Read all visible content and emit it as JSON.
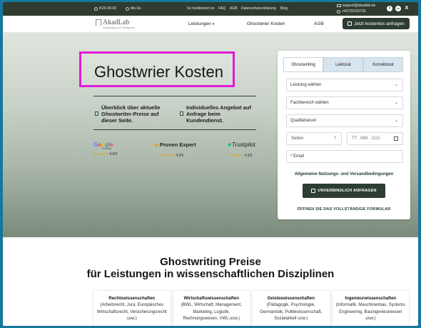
{
  "topbar": {
    "hours": "8.00-20.00",
    "days": "Mo-So",
    "links": [
      "So funktioniert es",
      "FAQ",
      "AGB",
      "Datenschutzerklärung",
      "Blog"
    ],
    "email": "support@akadlab.de",
    "phone": "+43720143726",
    "socials": [
      "f",
      "in",
      "X"
    ]
  },
  "header": {
    "logo_name": "AkadLab",
    "logo_sub": "Ghostwriting von Textagentur",
    "nav": [
      "Leistungen",
      "Ghostwrier Kosten",
      "AGB"
    ],
    "cta": "Jetzt kostenlos anfragen"
  },
  "hero": {
    "title": "Ghostwrier Kosten",
    "feature_left": "Überblick über aktuelle Ghostwriter-Preise auf dieser Seite.",
    "feature_right": "Individuelles Angebot auf Anfrage beim Kundendienst.",
    "ratings": [
      {
        "brand": "Google",
        "sub": "Reviews",
        "score": "4.9/5"
      },
      {
        "brand": "Proven Expert",
        "sub": "",
        "score": "4.9/5"
      },
      {
        "brand": "Trustpilot",
        "sub": "",
        "score": "4.9/5"
      }
    ]
  },
  "form": {
    "tabs": [
      "Ghostwriting",
      "Lektorat",
      "Korrektorat"
    ],
    "active_tab": 0,
    "select_service": "Leistung wählen",
    "select_field": "Fachbereich wählen",
    "select_quality": "Qualitätslevel",
    "pages_placeholder": "Seiten",
    "date_placeholder": "TT . MM . JJJJ",
    "email_placeholder": "* Email",
    "terms": "Allgemeine Nutzungs- und Versandbedingungen",
    "submit": "UNVERBINDLICH ANFRAGEN",
    "full_form": "ÖFFNEN SIE DAS VOLLSTÄNDIGE FORMULAR"
  },
  "section": {
    "heading_line1": "Ghostwriting Preise",
    "heading_line2": "für Leistungen in wissenschaftlichen Disziplinen",
    "cards": [
      {
        "title": "Rechtswissenschaften",
        "desc": "(Arbeitsrecht, Jura, Europäisches Wirtschaftsrecht, Versicherungsrecht usw.)"
      },
      {
        "title": "Wirtschaftswissenschaften",
        "desc": "(BWL, Wirtschaft, Management, Marketing, Logistik, Rechnungswesen, VWL usw.)"
      },
      {
        "title": "Geisteswissenschaften",
        "desc": "(Pädagogik, Psychologie, Germanistik, Politikwissenschaft, Sozialarbeit usw.)"
      },
      {
        "title": "Ingenieurwissenschaften",
        "desc": "(Informatik, Maschinenbau, Systems Engineering, Bauingenieurwesen usw.)"
      }
    ]
  },
  "colors": {
    "dark_green": "#2e3d32",
    "highlight": "#e21ad6",
    "page_border": "#16789a",
    "tab_inactive": "#d8e4ee"
  }
}
